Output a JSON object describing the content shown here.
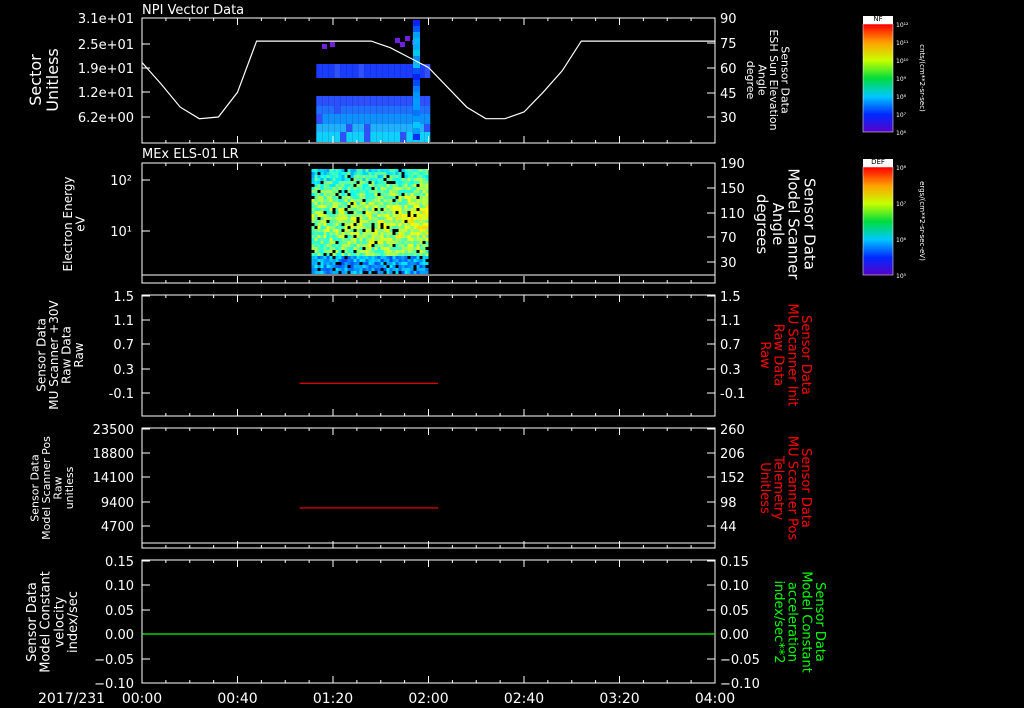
{
  "colors": {
    "white": "#ffffff",
    "red": "#ff0000",
    "green": "#00ff00"
  },
  "time_axis": {
    "date_label": "2017/231",
    "ticks": [
      "00:00",
      "00:40",
      "01:20",
      "02:00",
      "02:40",
      "03:20",
      "04:00"
    ],
    "minutes": [
      0,
      40,
      80,
      120,
      160,
      200,
      240
    ]
  },
  "chart_data": [
    {
      "type": "heatmap",
      "title": "NPI Vector Data",
      "ylabel_lines": [
        "Sector",
        "Unitless"
      ],
      "ytick_labels": [
        "3.1e+01",
        "2.5e+01",
        "1.9e+01",
        "1.2e+01",
        "6.2e+00"
      ],
      "right_axis": {
        "label_lines": [
          "Sensor Data",
          "ESH Sun Elevation",
          "Angle",
          "degree"
        ],
        "ticks": [
          "90",
          "75",
          "60",
          "45",
          "30"
        ],
        "range": [
          15,
          90
        ]
      },
      "line_series": {
        "name": "ESH Sun Elevation Angle",
        "x_minutes": [
          0,
          8,
          16,
          24,
          32,
          40,
          48,
          80,
          96,
          104,
          112,
          120,
          128,
          136,
          144,
          152,
          160,
          168,
          176,
          184,
          200,
          240
        ],
        "y": [
          63,
          50,
          36,
          29,
          30,
          45,
          76,
          76,
          76,
          72,
          66,
          60,
          48,
          36,
          29,
          29,
          33,
          45,
          58,
          76,
          76,
          76
        ]
      },
      "data_span_minutes": [
        73,
        119
      ],
      "colorbar": {
        "label": "NF",
        "units": "cnts/(cm**2-sr-sec)",
        "tick_labels": [
          "10¹²",
          "10¹¹",
          "10¹⁰",
          "10⁹",
          "10⁸",
          "10⁷",
          "10⁶"
        ]
      }
    },
    {
      "type": "heatmap",
      "title": "MEx ELS-01 LR",
      "ylabel_lines": [
        "Electron Energy",
        "eV"
      ],
      "ytick_labels": [
        "10²",
        "10¹"
      ],
      "right_axis": {
        "label_lines": [
          "Sensor Data",
          "Model Scanner",
          "Angle",
          "degrees"
        ],
        "ticks": [
          "190",
          "150",
          "110",
          "70",
          "30"
        ],
        "range": [
          0,
          190
        ]
      },
      "line_series": {
        "name": "Model Scanner Angle",
        "x_minutes": [
          0,
          240
        ],
        "y": [
          4,
          4
        ]
      },
      "data_span_minutes": [
        71,
        119
      ],
      "colorbar": {
        "label": "DEF",
        "units": "ergs/(cm**2-sr-sec-eV)",
        "tick_labels": [
          "10⁸",
          "10⁷",
          "10⁶",
          "10⁵"
        ]
      }
    },
    {
      "type": "line",
      "ylabel_lines": [
        "Sensor Data",
        "MU Scanner +30V",
        "Raw Data",
        "Raw"
      ],
      "ytick_labels": [
        "1.5",
        "1.1",
        "0.7",
        "0.3",
        "-0.1"
      ],
      "ylim": [
        -0.4,
        1.5
      ],
      "right_axis": {
        "label_lines": [
          "Sensor Data",
          "MU Scanner Init",
          "Raw Data",
          "Raw"
        ],
        "ticks": [
          "1.5",
          "1.1",
          "0.7",
          "0.3",
          "-0.1"
        ],
        "color": "#ff0000"
      },
      "series": [
        {
          "name": "MU Scanner Init",
          "color": "#ff0000",
          "x_minutes": [
            66,
            124
          ],
          "y": [
            0.06,
            0.06
          ]
        }
      ]
    },
    {
      "type": "line",
      "ylabel_lines": [
        "Sensor Data",
        "Model Scanner Pos",
        "Raw",
        "unitless"
      ],
      "ytick_labels": [
        "23500",
        "18800",
        "14100",
        "9400",
        "4700"
      ],
      "ylim": [
        0,
        23500
      ],
      "right_axis": {
        "label_lines": [
          "Sensor Data",
          "MU Scanner Pos",
          "Telemetry",
          "Unitless"
        ],
        "ticks": [
          "260",
          "206",
          "152",
          "98",
          "44"
        ],
        "color": "#ff0000"
      },
      "series": [
        {
          "name": "MU Scanner Pos",
          "color": "#ff0000",
          "x_minutes": [
            66,
            124
          ],
          "y": [
            8200,
            8200
          ]
        }
      ]
    },
    {
      "type": "line",
      "ylabel_lines": [
        "Sensor Data",
        "Model Constant",
        "velocity",
        "index/sec"
      ],
      "ytick_labels": [
        "0.15",
        "0.10",
        "0.05",
        "0.00",
        "−0.05",
        "−0.10"
      ],
      "ylim": [
        -0.1,
        0.15
      ],
      "right_axis": {
        "label_lines": [
          "Sensor Data",
          "Model Constant",
          "acceleration",
          "index/sec**2"
        ],
        "ticks": [
          "0.15",
          "0.10",
          "0.05",
          "0.00",
          "−0.05",
          "−0.10"
        ],
        "color": "#00ff00"
      },
      "series": [
        {
          "name": "Model Constant",
          "color": "#00ff00",
          "x_minutes": [
            0,
            240
          ],
          "y": [
            0.0,
            0.0
          ]
        }
      ]
    }
  ]
}
